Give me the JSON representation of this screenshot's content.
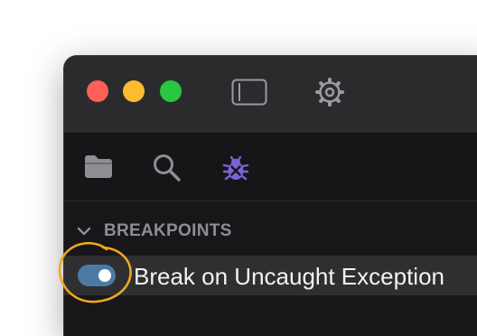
{
  "window": {
    "traffic_lights": {
      "close": "#fe5f57",
      "minimize": "#febc2e",
      "zoom": "#28c840"
    },
    "titlebar_icons": [
      "sidebar-toggle-icon",
      "gear-icon"
    ]
  },
  "toolbar": {
    "tools": [
      "folder-icon",
      "search-icon",
      "bug-icon"
    ],
    "active_tool": "bug-icon",
    "active_color": "#7d62d6"
  },
  "breakpoints": {
    "section_title": "BREAKPOINTS",
    "expanded": true,
    "items": [
      {
        "label": "Break on Uncaught Exception",
        "enabled": true
      }
    ]
  },
  "annotation": {
    "highlight_color": "#f2a81d",
    "target": "breakpoint-toggle"
  }
}
